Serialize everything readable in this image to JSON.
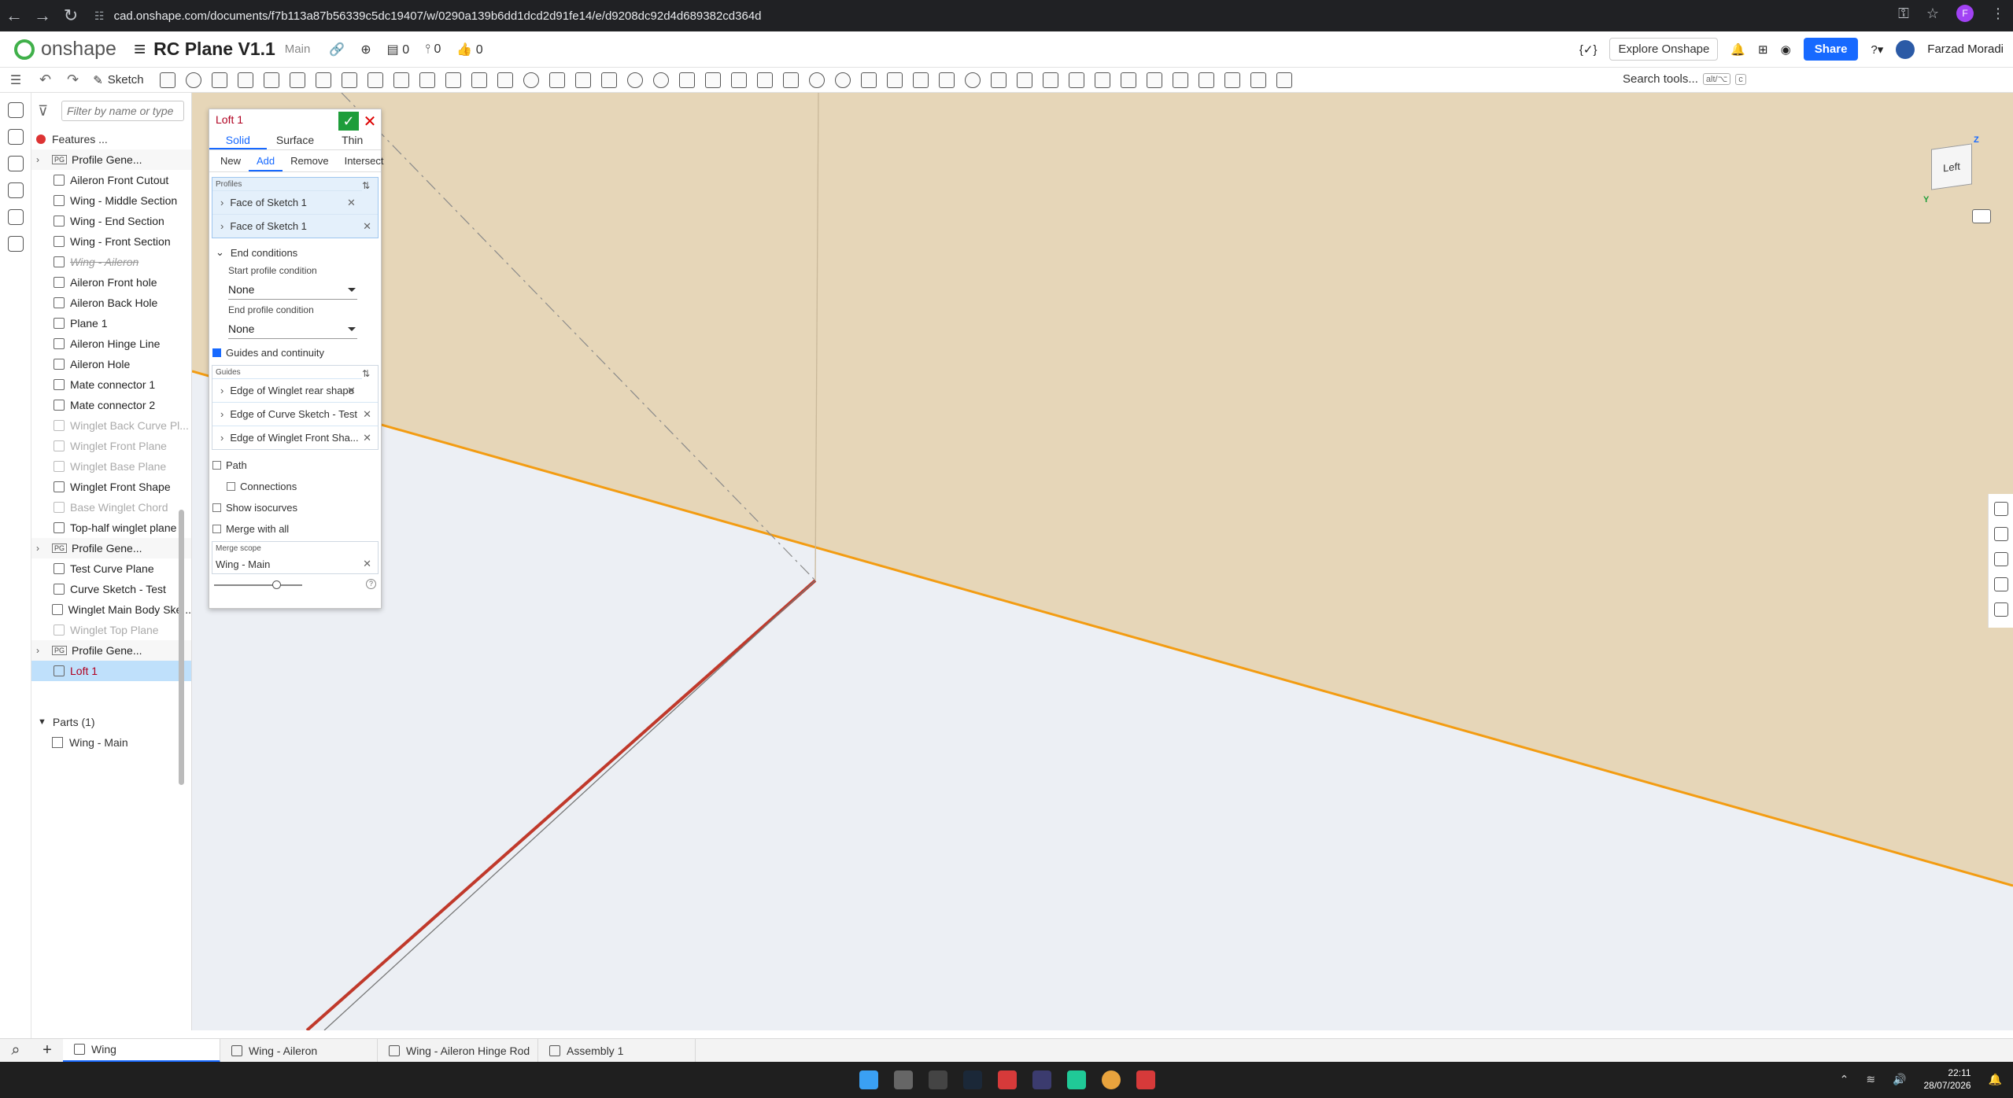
{
  "browser": {
    "url": "cad.onshape.com/documents/f7b113a87b56339c5dc19407/w/0290a139b6dd1dcd2d91fe14/e/d9208dc92d4d689382cd364d",
    "profile_initial": "F"
  },
  "header": {
    "brand": "onshape",
    "doc_title": "RC Plane V1.1",
    "branch": "Main",
    "counter_1": "0",
    "counter_2": "0",
    "counter_3": "0",
    "explore_label": "Explore Onshape",
    "share_label": "Share",
    "user_name": "Farzad Moradi"
  },
  "toolbar": {
    "sketch_label": "Sketch",
    "search_tools_label": "Search tools...",
    "search_shortcut_1": "alt/⌥",
    "search_shortcut_2": "c"
  },
  "feature_tree": {
    "filter_placeholder": "Filter by name or type",
    "header": "Features ...",
    "items": [
      {
        "label": "Profile Gene...",
        "state": "group"
      },
      {
        "label": "Aileron Front Cutout",
        "state": "normal"
      },
      {
        "label": "Wing - Middle Section",
        "state": "normal"
      },
      {
        "label": "Wing - End Section",
        "state": "normal"
      },
      {
        "label": "Wing - Front Section",
        "state": "normal"
      },
      {
        "label": "Wing - Aileron",
        "state": "struck"
      },
      {
        "label": "Aileron Front hole",
        "state": "normal"
      },
      {
        "label": "Aileron Back Hole",
        "state": "normal"
      },
      {
        "label": "Plane 1",
        "state": "normal"
      },
      {
        "label": "Aileron Hinge Line",
        "state": "normal"
      },
      {
        "label": "Aileron Hole",
        "state": "normal"
      },
      {
        "label": "Mate connector 1",
        "state": "normal"
      },
      {
        "label": "Mate connector 2",
        "state": "normal"
      },
      {
        "label": "Winglet Back Curve Pl...",
        "state": "suppressed"
      },
      {
        "label": "Winglet Front Plane",
        "state": "suppressed"
      },
      {
        "label": "Winglet Base Plane",
        "state": "suppressed"
      },
      {
        "label": "Winglet Front Shape",
        "state": "normal"
      },
      {
        "label": "Base Winglet Chord",
        "state": "suppressed"
      },
      {
        "label": "Top-half winglet plane",
        "state": "normal"
      },
      {
        "label": "Profile Gene...",
        "state": "group"
      },
      {
        "label": "Test Curve Plane",
        "state": "normal"
      },
      {
        "label": "Curve Sketch - Test",
        "state": "normal"
      },
      {
        "label": "Winglet Main Body Ske...",
        "state": "normal"
      },
      {
        "label": "Winglet Top Plane",
        "state": "suppressed"
      },
      {
        "label": "Profile Gene...",
        "state": "group"
      },
      {
        "label": "Loft 1",
        "state": "selected"
      }
    ],
    "parts_header": "Parts (1)",
    "parts": [
      "Wing - Main"
    ]
  },
  "loft_dialog": {
    "title": "Loft 1",
    "type_tabs": [
      "Solid",
      "Surface",
      "Thin"
    ],
    "op_tabs": [
      "New",
      "Add",
      "Remove",
      "Intersect"
    ],
    "profiles_label": "Profiles",
    "profiles": [
      "Face of Sketch 1",
      "Face of Sketch 1"
    ],
    "end_conditions_label": "End conditions",
    "start_condition_label": "Start profile condition",
    "start_condition_value": "None",
    "end_condition_label": "End profile condition",
    "end_condition_value": "None",
    "guides_continuity_label": "Guides and continuity",
    "guides_label": "Guides",
    "guides": [
      "Edge of Winglet rear shape",
      "Edge of Curve Sketch - Test",
      "Edge of Winglet Front Sha..."
    ],
    "path_label": "Path",
    "connections_label": "Connections",
    "isocurves_label": "Show isocurves",
    "merge_all_label": "Merge with all",
    "merge_scope_label": "Merge scope",
    "merge_scope_value": "Wing - Main",
    "help_label": "?"
  },
  "view_cube": {
    "face_label": "Left",
    "z": "Z",
    "y": "Y"
  },
  "tabs": [
    {
      "label": "Wing",
      "active": true
    },
    {
      "label": "Wing - Aileron",
      "active": false
    },
    {
      "label": "Wing - Aileron Hinge Rod",
      "active": false
    },
    {
      "label": "Assembly 1",
      "active": false
    }
  ],
  "taskbar": {
    "time": "22:11",
    "date": "28/07/2026"
  },
  "colors": {
    "plane_fill": "#e6d6b8",
    "plane_edge": "#f39c12",
    "selected_edge": "#c0392b",
    "accent": "#1769ff",
    "confirm": "#1e9d3a"
  }
}
